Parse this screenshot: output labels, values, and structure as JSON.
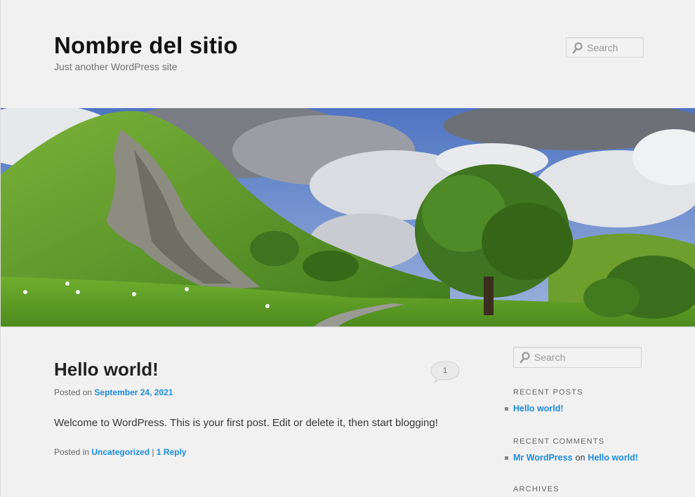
{
  "header": {
    "site_title": "Nombre del sitio",
    "site_description": "Just another WordPress site",
    "search_placeholder": "Search"
  },
  "post": {
    "title": "Hello world!",
    "comment_count": "1",
    "posted_on_prefix": "Posted on",
    "date": "September 24, 2021",
    "content": "Welcome to WordPress. This is your first post. Edit or delete it, then start blogging!",
    "posted_in_prefix": "Posted in",
    "category": "Uncategorized",
    "separator": "|",
    "reply_link": "1 Reply"
  },
  "sidebar": {
    "search_placeholder": "Search",
    "recent_posts_title": "RECENT POSTS",
    "recent_posts": [
      "Hello world!"
    ],
    "recent_comments_title": "RECENT COMMENTS",
    "recent_comment": {
      "author": "Mr WordPress",
      "on": "on",
      "post": "Hello world!"
    },
    "archives_title": "ARCHIVES"
  },
  "colors": {
    "background": "#f1f1f1",
    "link": "#1b8be0",
    "title": "#111111"
  }
}
